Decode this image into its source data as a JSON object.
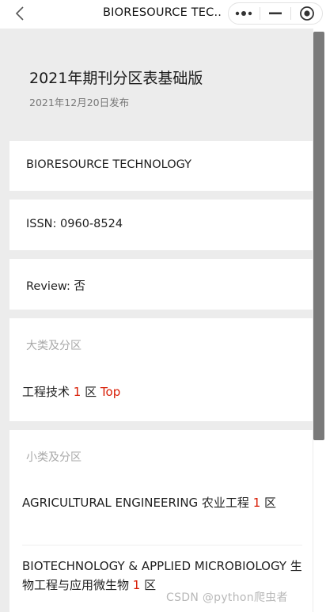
{
  "nav": {
    "title": "BIORESOURCE TEC..."
  },
  "header": {
    "title": "2021年期刊分区表基础版",
    "date": "2021年12月20日发布"
  },
  "journal": {
    "name": "BIORESOURCE TECHNOLOGY",
    "issn": "ISSN: 0960-8524",
    "review": "Review: 否"
  },
  "major": {
    "label": "大类及分区",
    "category": "工程技术",
    "zone_num": "1",
    "zone_suffix": "区",
    "top": "Top"
  },
  "minor": {
    "label": "小类及分区",
    "items": [
      {
        "name": "AGRICULTURAL ENGINEERING 农业工程",
        "zone_num": "1",
        "zone_suffix": "区"
      },
      {
        "name": "BIOTECHNOLOGY & APPLIED MICROBIOLOGY 生物工程与应用微生物",
        "zone_num": "1",
        "zone_suffix": "区"
      }
    ]
  },
  "watermark": "CSDN @python爬虫者",
  "colors": {
    "accent": "#d81e06",
    "muted": "#a8a8a8",
    "background": "#ececec"
  },
  "icons": [
    "back-icon",
    "more-icon",
    "minimize-icon",
    "close-target-icon"
  ]
}
